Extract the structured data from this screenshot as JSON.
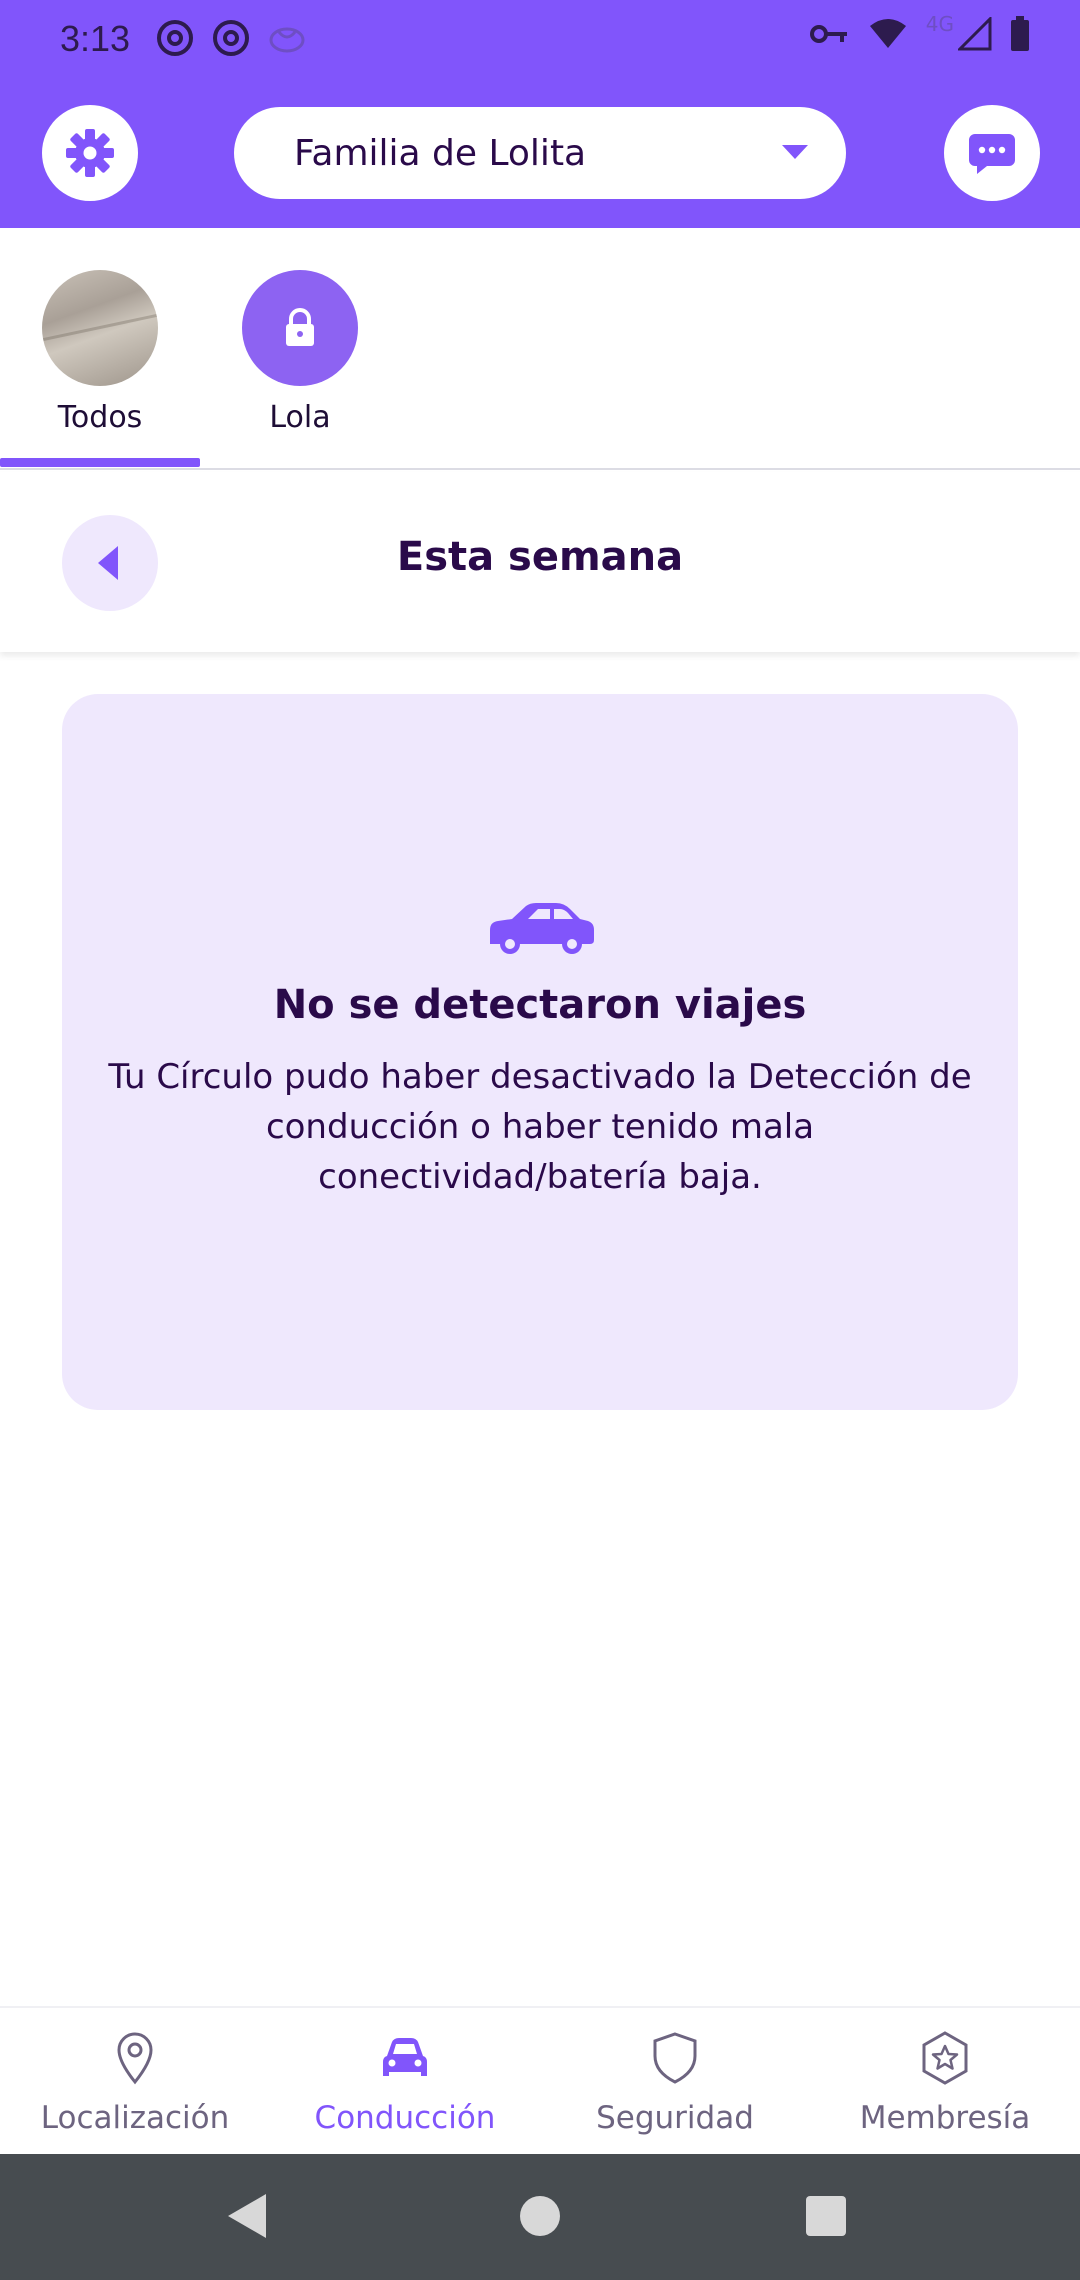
{
  "status_bar": {
    "time": "3:13",
    "left_icons": [
      "at-sign-icon",
      "at-sign-icon",
      "brain-icon"
    ],
    "right_icons": [
      "key-icon",
      "wifi-icon",
      "network-4g-icon",
      "signal-icon",
      "battery-icon"
    ],
    "network_label": "4G"
  },
  "app_bar": {
    "circle_name": "Familia de Lolita",
    "settings_icon": "gear-icon",
    "chat_icon": "chat-bubble-icon"
  },
  "members": [
    {
      "name": "Todos",
      "selected": true
    },
    {
      "name": "Lola",
      "locked": true
    }
  ],
  "week_nav": {
    "title": "Esta semana"
  },
  "empty_state": {
    "icon": "car-icon",
    "title": "No se detectaron viajes",
    "body": "Tu Círculo pudo haber desactivado la Detección de conducción o haber tenido mala conectividad/batería baja."
  },
  "bottom_nav": [
    {
      "label": "Localización",
      "icon": "location-pin-icon"
    },
    {
      "label": "Conducción",
      "icon": "car-icon",
      "active": true
    },
    {
      "label": "Seguridad",
      "icon": "shield-icon"
    },
    {
      "label": "Membresía",
      "icon": "star-badge-icon"
    }
  ],
  "colors": {
    "brand": "#8155fb",
    "card_bg": "#efe8fd",
    "text_dark": "#2a0a4a",
    "nav_inactive": "#6d6480"
  }
}
